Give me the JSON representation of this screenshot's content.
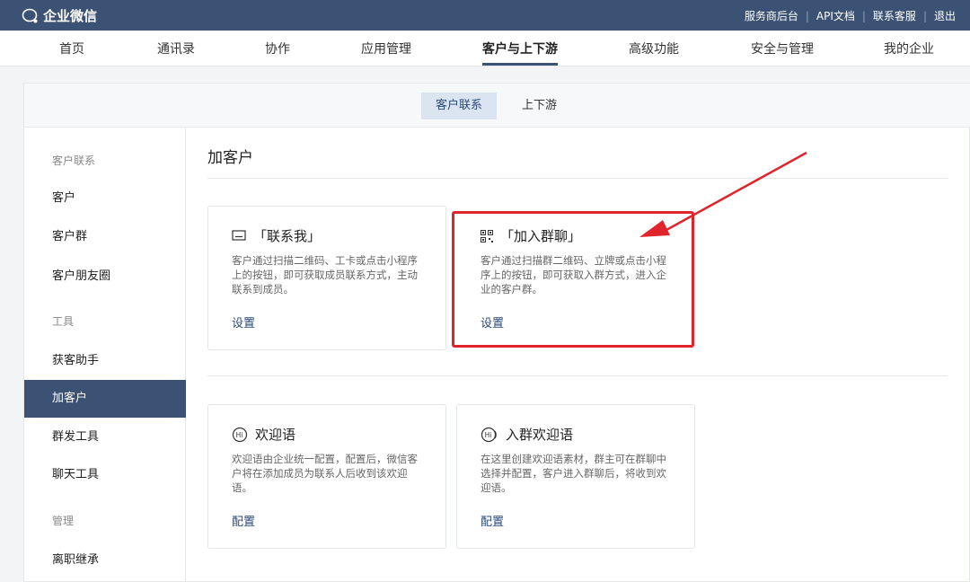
{
  "topbar": {
    "logo_text": "企业微信",
    "links": [
      "服务商后台",
      "API文档",
      "联系客服",
      "退出"
    ]
  },
  "nav": {
    "items": [
      "首页",
      "通讯录",
      "协作",
      "应用管理",
      "客户与上下游",
      "高级功能",
      "安全与管理",
      "我的企业"
    ],
    "active": "客户与上下游"
  },
  "subtabs": {
    "active": "客户联系",
    "other": "上下游"
  },
  "sidebar": {
    "items": [
      {
        "label": "客户联系",
        "type": "group"
      },
      {
        "label": "客户",
        "type": "item"
      },
      {
        "label": "客户群",
        "type": "item"
      },
      {
        "label": "客户朋友圈",
        "type": "item"
      },
      {
        "label": "工具",
        "type": "group"
      },
      {
        "label": "获客助手",
        "type": "item"
      },
      {
        "label": "加客户",
        "type": "active"
      },
      {
        "label": "群发工具",
        "type": "item"
      },
      {
        "label": "聊天工具",
        "type": "item"
      },
      {
        "label": "管理",
        "type": "group"
      },
      {
        "label": "离职继承",
        "type": "item"
      }
    ]
  },
  "content": {
    "title": "加客户",
    "cards": [
      {
        "icon": "contact-card-icon",
        "title": "「联系我」",
        "desc": "客户通过扫描二维码、工卡或点击小程序上的按钮，即可获取成员联系方式，主动联系到成员。",
        "link": "设置"
      },
      {
        "icon": "qr-code-icon",
        "title": "「加入群聊」",
        "desc": "客户通过扫描群二维码、立牌或点击小程序上的按钮，即可获取入群方式，进入企业的客户群。",
        "link": "设置"
      },
      {
        "icon": "hi-bubble-icon",
        "title": "欢迎语",
        "desc": "欢迎语由企业统一配置，配置后，微信客户将在添加成员为联系人后收到该欢迎语。",
        "link": "配置"
      },
      {
        "icon": "hi-group-icon",
        "title": "入群欢迎语",
        "desc": "在这里创建欢迎语素材，群主可在群聊中选择并配置，客户进入群聊后，将收到欢迎语。",
        "link": "配置"
      }
    ]
  },
  "annotation_color": "#e0242b",
  "brand_color": "#3b5274"
}
